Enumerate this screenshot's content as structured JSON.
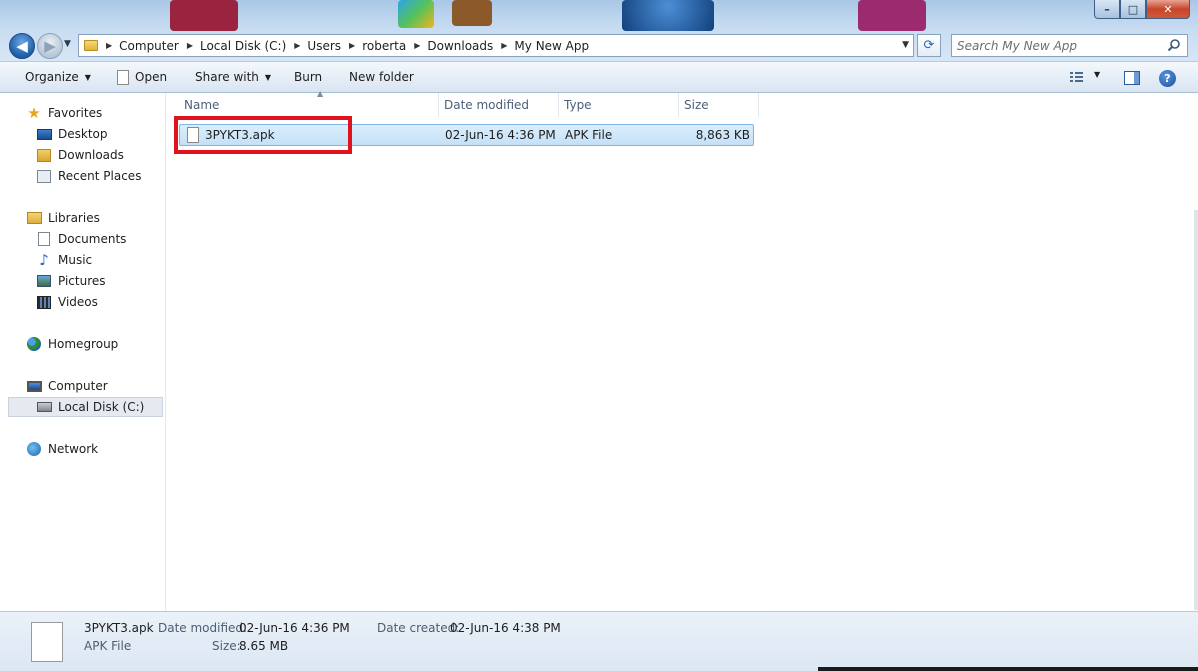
{
  "window": {
    "controls": {
      "minimize": "–",
      "maximize": "□",
      "close": "✕"
    }
  },
  "address": {
    "crumbs": [
      "Computer",
      "Local Disk (C:)",
      "Users",
      "roberta",
      "Downloads",
      "My New App"
    ],
    "search_placeholder": "Search My New App"
  },
  "toolbar": {
    "organize": "Organize",
    "open": "Open",
    "share_with": "Share with",
    "burn": "Burn",
    "new_folder": "New folder"
  },
  "sidebar": {
    "favorites": {
      "label": "Favorites",
      "items": [
        "Desktop",
        "Downloads",
        "Recent Places"
      ]
    },
    "libraries": {
      "label": "Libraries",
      "items": [
        "Documents",
        "Music",
        "Pictures",
        "Videos"
      ]
    },
    "homegroup": "Homegroup",
    "computer": {
      "label": "Computer",
      "items": [
        "Local Disk (C:)"
      ]
    },
    "network": "Network"
  },
  "columns": {
    "name": "Name",
    "date_modified": "Date modified",
    "type": "Type",
    "size": "Size"
  },
  "files": [
    {
      "name": "3PYKT3.apk",
      "date_modified": "02-Jun-16 4:36 PM",
      "type": "APK File",
      "size": "8,863 KB"
    }
  ],
  "details": {
    "name": "3PYKT3.apk",
    "type": "APK File",
    "date_modified_label": "Date modified:",
    "date_modified": "02-Jun-16 4:36 PM",
    "size_label": "Size:",
    "size": "8.65 MB",
    "date_created_label": "Date created:",
    "date_created": "02-Jun-16 4:38 PM"
  },
  "colors": {
    "highlight": "#e0121b",
    "selection": "#c4e1f8",
    "accent": "#1f5ea5"
  }
}
